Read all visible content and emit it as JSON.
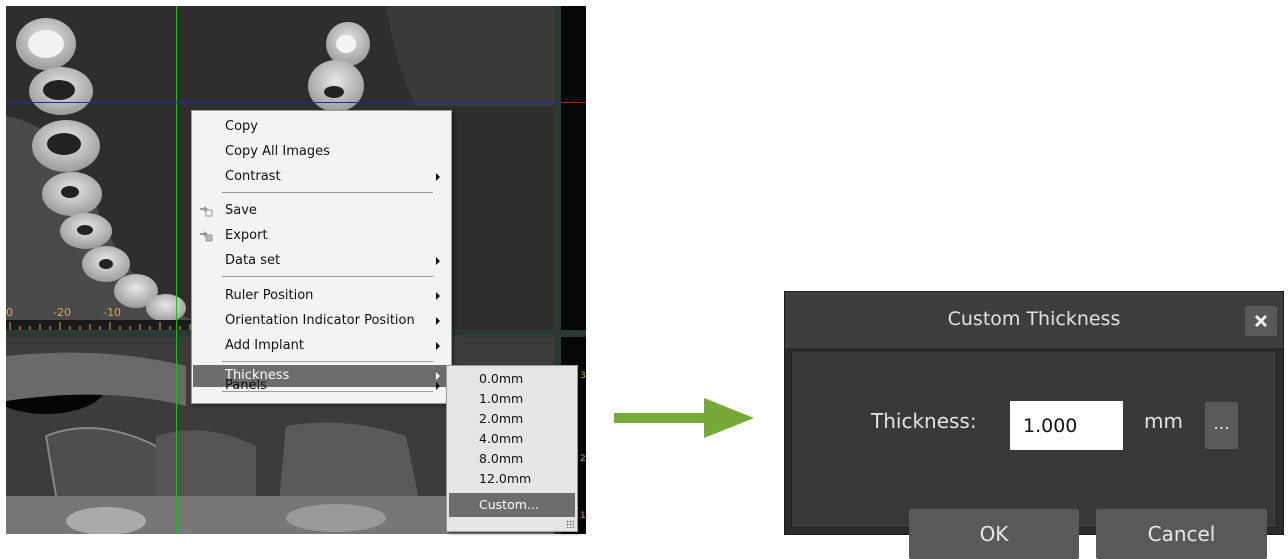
{
  "viewer": {
    "ruler_labels": [
      "0",
      "-20",
      "-10"
    ],
    "right_marks": [
      "3",
      "2",
      "1"
    ]
  },
  "context_menu": {
    "items": [
      {
        "label": "Copy",
        "icon": "",
        "submenu": false
      },
      {
        "label": "Copy All Images",
        "icon": "",
        "submenu": false
      },
      {
        "label": "Contrast",
        "icon": "",
        "submenu": true
      },
      {
        "label": "Save",
        "icon": "save-icon",
        "submenu": false
      },
      {
        "label": "Export",
        "icon": "export-icon",
        "submenu": false
      },
      {
        "label": "Data set",
        "icon": "",
        "submenu": true
      },
      {
        "label": "Ruler Position",
        "icon": "",
        "submenu": true
      },
      {
        "label": "Orientation Indicator Position",
        "icon": "",
        "submenu": true
      },
      {
        "label": "Add Implant",
        "icon": "",
        "submenu": true
      },
      {
        "label": "Thickness",
        "icon": "",
        "submenu": true,
        "highlighted": true
      },
      {
        "label": "Panels",
        "icon": "",
        "submenu": true
      }
    ]
  },
  "thickness_submenu": {
    "items": [
      "0.0mm",
      "1.0mm",
      "2.0mm",
      "4.0mm",
      "8.0mm",
      "12.0mm",
      "Custom..."
    ],
    "selected": "Custom..."
  },
  "dialog": {
    "title": "Custom Thickness",
    "close_icon": "close-icon",
    "thickness_label": "Thickness:",
    "thickness_value": "1.000",
    "unit": "mm",
    "browse_label": "...",
    "ok_label": "OK",
    "cancel_label": "Cancel"
  },
  "colors": {
    "arrow": "#76a83a",
    "crosshair_vertical": "#1fb81f",
    "crosshair_horizontal": "#1a2fae",
    "menu_highlight": "#6d6d6d",
    "dialog_bg": "#393939"
  }
}
